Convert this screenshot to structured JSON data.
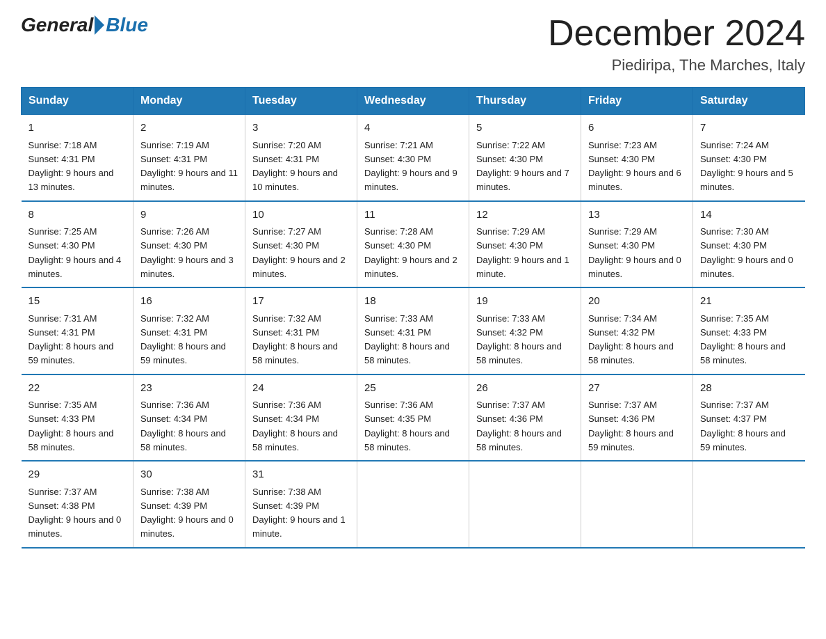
{
  "header": {
    "logo_general": "General",
    "logo_blue": "Blue",
    "month_title": "December 2024",
    "location": "Piediripa, The Marches, Italy"
  },
  "days_of_week": [
    "Sunday",
    "Monday",
    "Tuesday",
    "Wednesday",
    "Thursday",
    "Friday",
    "Saturday"
  ],
  "weeks": [
    [
      {
        "num": "1",
        "sunrise": "7:18 AM",
        "sunset": "4:31 PM",
        "daylight": "9 hours and 13 minutes."
      },
      {
        "num": "2",
        "sunrise": "7:19 AM",
        "sunset": "4:31 PM",
        "daylight": "9 hours and 11 minutes."
      },
      {
        "num": "3",
        "sunrise": "7:20 AM",
        "sunset": "4:31 PM",
        "daylight": "9 hours and 10 minutes."
      },
      {
        "num": "4",
        "sunrise": "7:21 AM",
        "sunset": "4:30 PM",
        "daylight": "9 hours and 9 minutes."
      },
      {
        "num": "5",
        "sunrise": "7:22 AM",
        "sunset": "4:30 PM",
        "daylight": "9 hours and 7 minutes."
      },
      {
        "num": "6",
        "sunrise": "7:23 AM",
        "sunset": "4:30 PM",
        "daylight": "9 hours and 6 minutes."
      },
      {
        "num": "7",
        "sunrise": "7:24 AM",
        "sunset": "4:30 PM",
        "daylight": "9 hours and 5 minutes."
      }
    ],
    [
      {
        "num": "8",
        "sunrise": "7:25 AM",
        "sunset": "4:30 PM",
        "daylight": "9 hours and 4 minutes."
      },
      {
        "num": "9",
        "sunrise": "7:26 AM",
        "sunset": "4:30 PM",
        "daylight": "9 hours and 3 minutes."
      },
      {
        "num": "10",
        "sunrise": "7:27 AM",
        "sunset": "4:30 PM",
        "daylight": "9 hours and 2 minutes."
      },
      {
        "num": "11",
        "sunrise": "7:28 AM",
        "sunset": "4:30 PM",
        "daylight": "9 hours and 2 minutes."
      },
      {
        "num": "12",
        "sunrise": "7:29 AM",
        "sunset": "4:30 PM",
        "daylight": "9 hours and 1 minute."
      },
      {
        "num": "13",
        "sunrise": "7:29 AM",
        "sunset": "4:30 PM",
        "daylight": "9 hours and 0 minutes."
      },
      {
        "num": "14",
        "sunrise": "7:30 AM",
        "sunset": "4:30 PM",
        "daylight": "9 hours and 0 minutes."
      }
    ],
    [
      {
        "num": "15",
        "sunrise": "7:31 AM",
        "sunset": "4:31 PM",
        "daylight": "8 hours and 59 minutes."
      },
      {
        "num": "16",
        "sunrise": "7:32 AM",
        "sunset": "4:31 PM",
        "daylight": "8 hours and 59 minutes."
      },
      {
        "num": "17",
        "sunrise": "7:32 AM",
        "sunset": "4:31 PM",
        "daylight": "8 hours and 58 minutes."
      },
      {
        "num": "18",
        "sunrise": "7:33 AM",
        "sunset": "4:31 PM",
        "daylight": "8 hours and 58 minutes."
      },
      {
        "num": "19",
        "sunrise": "7:33 AM",
        "sunset": "4:32 PM",
        "daylight": "8 hours and 58 minutes."
      },
      {
        "num": "20",
        "sunrise": "7:34 AM",
        "sunset": "4:32 PM",
        "daylight": "8 hours and 58 minutes."
      },
      {
        "num": "21",
        "sunrise": "7:35 AM",
        "sunset": "4:33 PM",
        "daylight": "8 hours and 58 minutes."
      }
    ],
    [
      {
        "num": "22",
        "sunrise": "7:35 AM",
        "sunset": "4:33 PM",
        "daylight": "8 hours and 58 minutes."
      },
      {
        "num": "23",
        "sunrise": "7:36 AM",
        "sunset": "4:34 PM",
        "daylight": "8 hours and 58 minutes."
      },
      {
        "num": "24",
        "sunrise": "7:36 AM",
        "sunset": "4:34 PM",
        "daylight": "8 hours and 58 minutes."
      },
      {
        "num": "25",
        "sunrise": "7:36 AM",
        "sunset": "4:35 PM",
        "daylight": "8 hours and 58 minutes."
      },
      {
        "num": "26",
        "sunrise": "7:37 AM",
        "sunset": "4:36 PM",
        "daylight": "8 hours and 58 minutes."
      },
      {
        "num": "27",
        "sunrise": "7:37 AM",
        "sunset": "4:36 PM",
        "daylight": "8 hours and 59 minutes."
      },
      {
        "num": "28",
        "sunrise": "7:37 AM",
        "sunset": "4:37 PM",
        "daylight": "8 hours and 59 minutes."
      }
    ],
    [
      {
        "num": "29",
        "sunrise": "7:37 AM",
        "sunset": "4:38 PM",
        "daylight": "9 hours and 0 minutes."
      },
      {
        "num": "30",
        "sunrise": "7:38 AM",
        "sunset": "4:39 PM",
        "daylight": "9 hours and 0 minutes."
      },
      {
        "num": "31",
        "sunrise": "7:38 AM",
        "sunset": "4:39 PM",
        "daylight": "9 hours and 1 minute."
      },
      null,
      null,
      null,
      null
    ]
  ]
}
